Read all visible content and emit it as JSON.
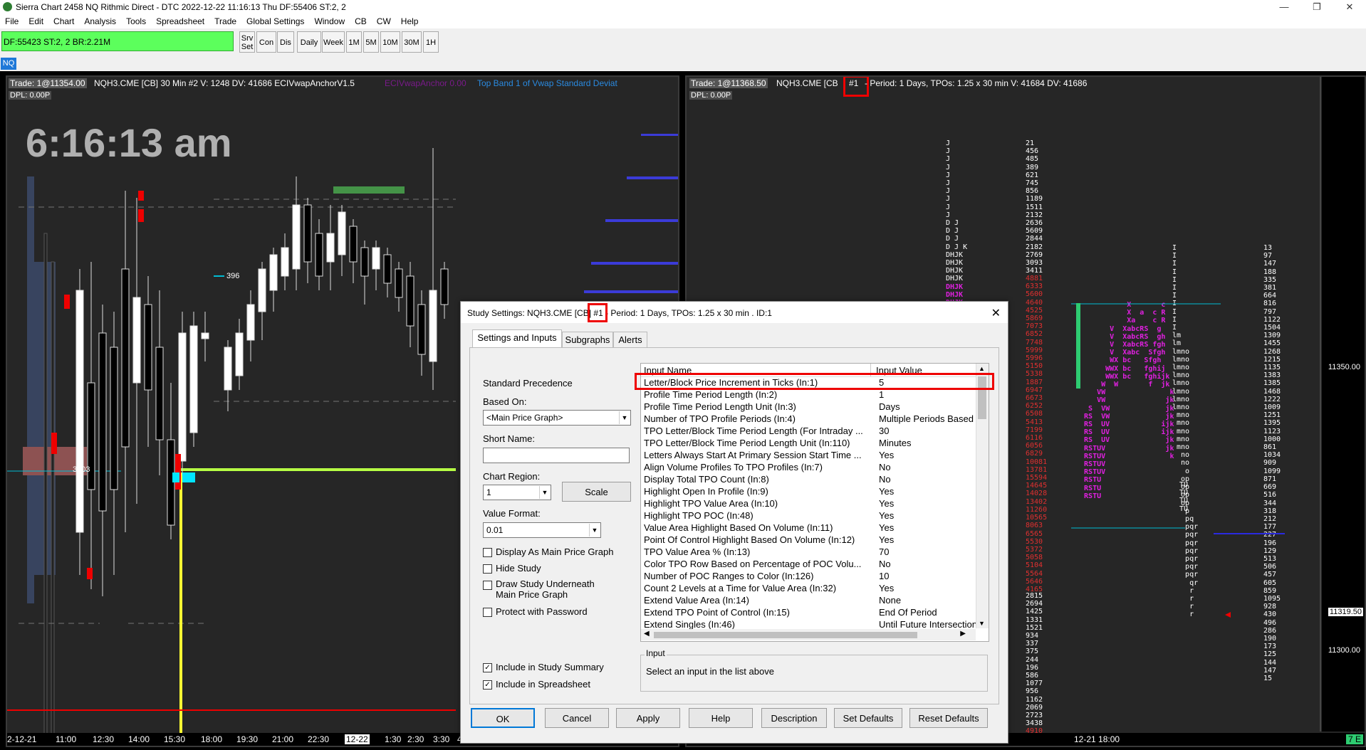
{
  "window": {
    "title": "Sierra Chart 2458 NQ  Rithmic Direct - DTC 2022-12-22  11:16:13 Thu  DF:55406  ST:2, 2"
  },
  "menu": [
    "File",
    "Edit",
    "Chart",
    "Analysis",
    "Tools",
    "Spreadsheet",
    "Trade",
    "Global Settings",
    "Window",
    "CB",
    "CW",
    "Help"
  ],
  "toolbar": {
    "status": "DF:55423  ST:2, 2  BR:2.21M",
    "buttons": [
      "Srv\nSet",
      "Con",
      "Dis",
      "Daily",
      "Week",
      "1M",
      "5M",
      "10M",
      "30M",
      "1H"
    ]
  },
  "tab_label": "NQ",
  "left_chart": {
    "trade": "Trade: 1@11354.00",
    "header_rest": "NQH3.CME [CB]  30 Min   #2 V: 1248  DV: 41686  ECIVwapAnchorV1.5",
    "study_a": "ECIVwapAnchor 0.00",
    "study_b": "Top Band 1 of Vwap Standard Deviat",
    "dpl": "DPL: 0.00P",
    "clock": "6:16:13 am",
    "label_396": "396",
    "label_3603": "3603",
    "x_labels": [
      "2-12-21",
      "11:00",
      "12:30",
      "14:00",
      "15:30",
      "18:00",
      "19:30",
      "21:00",
      "22:30",
      "12-22",
      "1:30",
      "2:30",
      "3:30",
      "4"
    ]
  },
  "right_chart": {
    "trade": "Trade: 1@11368.50",
    "symbol": "NQH3.CME [CB",
    "id": "#1",
    "header_rest": " - Period: 1 Days, TPOs: 1.25 x 30 min    V: 41684  DV: 41686",
    "dpl": "DPL: 0.00P",
    "price_labels": [
      "11350.00",
      "11319.50",
      "11300.00"
    ],
    "x_labels": [
      "12-21  18:00"
    ],
    "corner": "7 E"
  },
  "dialog": {
    "title_prefix": "Study Settings: NQH3.CME [CB] ",
    "title_id": "#1",
    "title_suffix": " - Period: 1 Days, TPOs: 1.25 x 30 min  . ID:1",
    "close": "✕",
    "tabs": [
      "Settings and Inputs",
      "Subgraphs",
      "Alerts"
    ],
    "standard_precedence": "Standard Precedence",
    "based_on_label": "Based On:",
    "based_on_value": "<Main Price Graph>",
    "short_name_label": "Short Name:",
    "short_name_value": "",
    "chart_region_label": "Chart Region:",
    "chart_region_value": "1",
    "scale_button": "Scale",
    "value_format_label": "Value Format:",
    "value_format_value": "0.01",
    "checks": [
      {
        "label": "Display As Main Price Graph",
        "checked": false
      },
      {
        "label": "Hide Study",
        "checked": false
      },
      {
        "label": "Draw Study Underneath\nMain Price Graph",
        "checked": false
      },
      {
        "label": "Protect with Password",
        "checked": false
      },
      {
        "label": "Include in Study Summary",
        "checked": true
      },
      {
        "label": "Include in Spreadsheet",
        "checked": true
      }
    ],
    "grid_header": {
      "name": "Input Name",
      "value": "Input Value"
    },
    "inputs": [
      {
        "name": "Letter/Block Price Increment in Ticks  (In:1)",
        "value": "5"
      },
      {
        "name": "Profile Time Period Length  (In:2)",
        "value": "1"
      },
      {
        "name": "Profile Time Period Length Unit  (In:3)",
        "value": "Days"
      },
      {
        "name": "Number of TPO Profile Periods  (In:4)",
        "value": "Multiple Periods Based"
      },
      {
        "name": "TPO Letter/Block Time Period Length (For Intraday ...",
        "value": "30"
      },
      {
        "name": "TPO Letter/Block Time Period Length Unit  (In:110)",
        "value": "Minutes"
      },
      {
        "name": "Letters Always Start At Primary Session Start Time  ...",
        "value": "Yes"
      },
      {
        "name": "Align Volume Profiles To TPO Profiles  (In:7)",
        "value": "No"
      },
      {
        "name": "Display Total TPO Count  (In:8)",
        "value": "No"
      },
      {
        "name": "Highlight Open In Profile  (In:9)",
        "value": "Yes"
      },
      {
        "name": "Highlight TPO Value Area  (In:10)",
        "value": "Yes"
      },
      {
        "name": "Highlight TPO POC  (In:48)",
        "value": "Yes"
      },
      {
        "name": "Value Area Highlight Based On Volume  (In:11)",
        "value": "Yes"
      },
      {
        "name": "Point Of Control Highlight Based On Volume  (In:12)",
        "value": "Yes"
      },
      {
        "name": "TPO Value Area %  (In:13)",
        "value": "70"
      },
      {
        "name": "Color TPO Row Based on Percentage of POC Volu...",
        "value": "No"
      },
      {
        "name": "Number of POC Ranges to Color  (In:126)",
        "value": "10"
      },
      {
        "name": "Count 2 Levels at a Time for Value Area  (In:32)",
        "value": "Yes"
      },
      {
        "name": "Extend Value Area  (In:14)",
        "value": "None"
      },
      {
        "name": "Extend TPO Point of Control  (In:15)",
        "value": "End Of Period"
      },
      {
        "name": "Extend Singles  (In:46)",
        "value": "Until Future Intersection"
      }
    ],
    "input_group_label": "Input",
    "input_help": "Select an input in the list above",
    "buttons": [
      "OK",
      "Cancel",
      "Apply",
      "Help",
      "Description",
      "Set Defaults",
      "Reset Defaults"
    ]
  },
  "colors": {
    "status_green": "#5cff5c",
    "accent_red": "#e00000",
    "tpo_magenta": "#e020e0",
    "tpo_white": "#ffffff",
    "tpo_red": "#e03030",
    "tab_blue": "#1e78d8"
  }
}
